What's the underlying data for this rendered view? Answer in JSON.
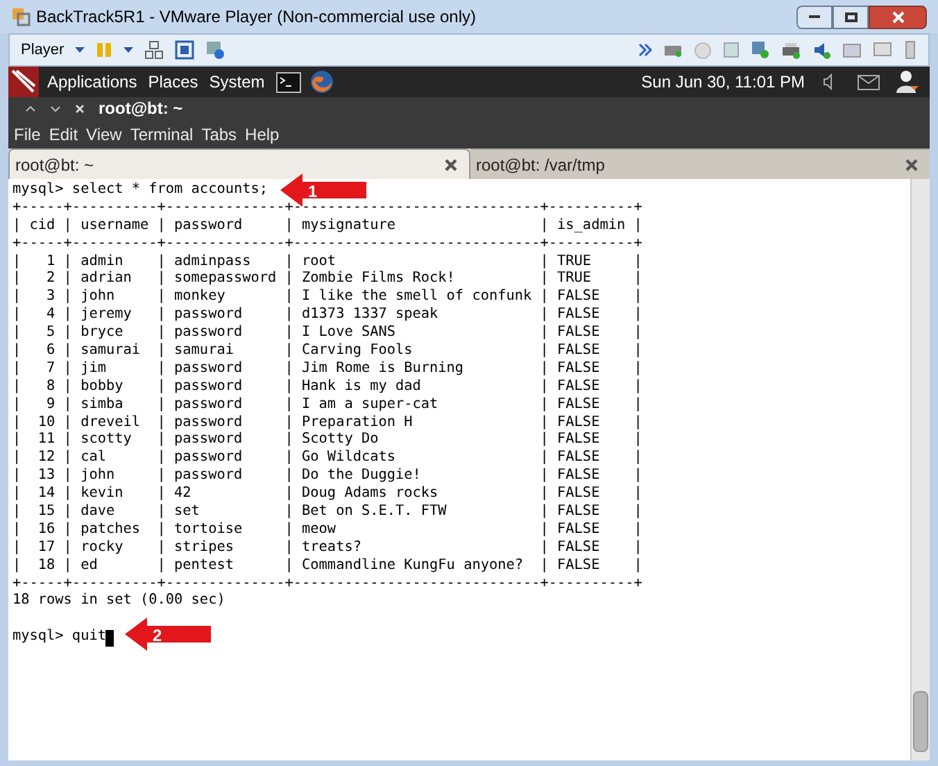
{
  "window": {
    "title": "BackTrack5R1 - VMware Player (Non-commercial use only)"
  },
  "toolbar": {
    "player_menu": "Player"
  },
  "panel": {
    "menus": [
      "Applications",
      "Places",
      "System"
    ],
    "clock": "Sun Jun 30, 11:01 PM"
  },
  "terminal_window": {
    "title": "root@bt: ~",
    "menu": [
      "File",
      "Edit",
      "View",
      "Terminal",
      "Tabs",
      "Help"
    ]
  },
  "tabs": [
    {
      "label": "root@bt: ~",
      "selected": true
    },
    {
      "label": "root@bt: /var/tmp",
      "selected": false
    }
  ],
  "terminal": {
    "lines": [
      "mysql> select * from accounts;",
      "+-----+----------+--------------+-----------------------------+----------+",
      "| cid | username | password     | mysignature                 | is_admin |",
      "+-----+----------+--------------+-----------------------------+----------+",
      "|   1 | admin    | adminpass    | root                        | TRUE     |",
      "|   2 | adrian   | somepassword | Zombie Films Rock!          | TRUE     |",
      "|   3 | john     | monkey       | I like the smell of confunk | FALSE    |",
      "|   4 | jeremy   | password     | d1373 1337 speak            | FALSE    |",
      "|   5 | bryce    | password     | I Love SANS                 | FALSE    |",
      "|   6 | samurai  | samurai      | Carving Fools               | FALSE    |",
      "|   7 | jim      | password     | Jim Rome is Burning         | FALSE    |",
      "|   8 | bobby    | password     | Hank is my dad              | FALSE    |",
      "|   9 | simba    | password     | I am a super-cat            | FALSE    |",
      "|  10 | dreveil  | password     | Preparation H               | FALSE    |",
      "|  11 | scotty   | password     | Scotty Do                   | FALSE    |",
      "|  12 | cal      | password     | Go Wildcats                 | FALSE    |",
      "|  13 | john     | password     | Do the Duggie!              | FALSE    |",
      "|  14 | kevin    | 42           | Doug Adams rocks            | FALSE    |",
      "|  15 | dave     | set          | Bet on S.E.T. FTW           | FALSE    |",
      "|  16 | patches  | tortoise     | meow                        | FALSE    |",
      "|  17 | rocky    | stripes      | treats?                     | FALSE    |",
      "|  18 | ed       | pentest      | Commandline KungFu anyone?  | FALSE    |",
      "+-----+----------+--------------+-----------------------------+----------+",
      "18 rows in set (0.00 sec)"
    ],
    "prompt_line": "mysql> quit",
    "cursor": true
  },
  "annotations": [
    {
      "label": "1"
    },
    {
      "label": "2"
    }
  ]
}
